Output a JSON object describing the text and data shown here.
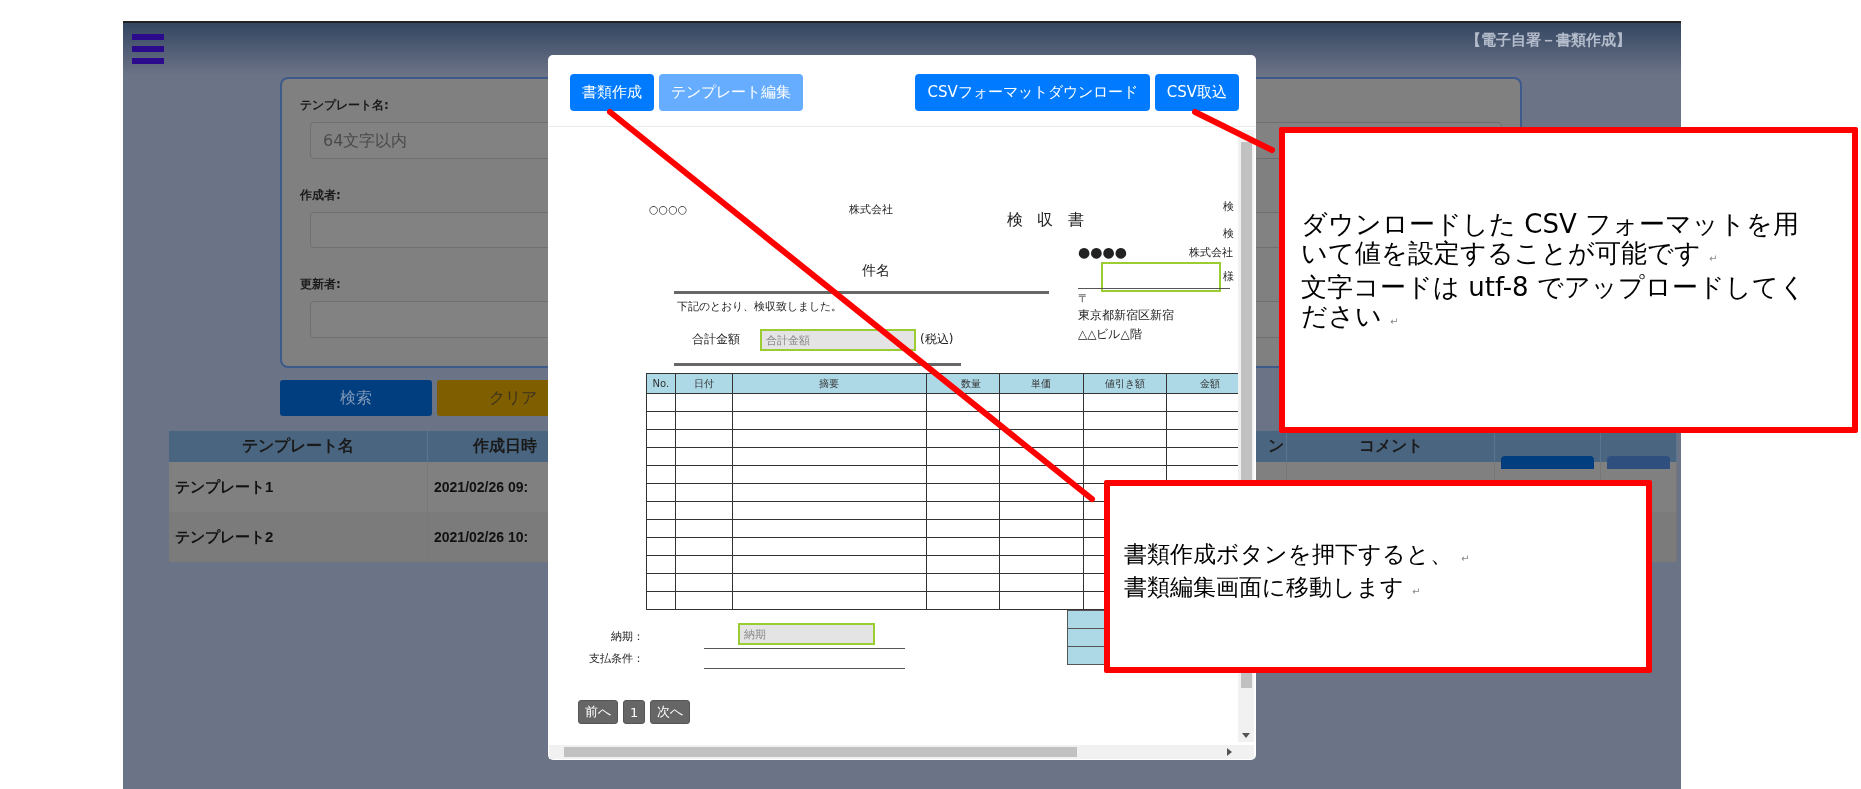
{
  "app_header": {
    "title": "【電子自署－書類作成】"
  },
  "search_form": {
    "fields": [
      {
        "label": "テンプレート名:",
        "placeholder": "64文字以内"
      },
      {
        "label": "作成者:"
      },
      {
        "label": "更新者:"
      }
    ],
    "buttons": [
      {
        "label": "検索",
        "kind": "primary"
      },
      {
        "label": "クリア",
        "kind": "warning"
      }
    ]
  },
  "template_table": {
    "columns": [
      "テンプレート名",
      "作成日時",
      "ン",
      "コメント"
    ],
    "rows": [
      {
        "cells": [
          "テンプレート1",
          "2021/02/26 09:"
        ]
      },
      {
        "cells": [
          "テンプレート2",
          "2021/02/26 10:"
        ]
      }
    ]
  },
  "modal": {
    "buttons": [
      {
        "label": "書類作成",
        "disabled": false
      },
      {
        "label": "テンプレート編集",
        "disabled": true
      },
      {
        "label": "CSVフォーマットダウンロード",
        "disabled": false
      },
      {
        "label": "CSV取込",
        "disabled": false
      }
    ],
    "document": {
      "sender": "○○○○",
      "sender_suffix": "株式会社",
      "title": "検収書",
      "right_labels": [
        "検",
        "検"
      ],
      "subject": "件名",
      "statement": "下記のとおり、検収致しました。",
      "total_label": "合計金額",
      "total_field": {
        "placeholder": "合計金額"
      },
      "tax_note": "(税込)",
      "recipient": {
        "name": "●●●●",
        "suffix": "株式会社",
        "honorific": "様",
        "postal_mark": "〒",
        "address_lines": [
          "東京都新宿区新宿",
          "△△ビル△階"
        ]
      },
      "items_table": {
        "columns": [
          "No.",
          "日付",
          "摘要",
          "数量",
          "単価",
          "値引き額",
          "金額"
        ]
      },
      "delivery": {
        "label": "納期：",
        "placeholder": "納期"
      },
      "payment_label": "支払条件："
    },
    "pagination": [
      "前へ",
      "1",
      "次へ"
    ]
  },
  "callouts": [
    {
      "lines": [
        {
          "text": "ダウンロードした CSV フォーマットを用"
        },
        {
          "text": "いて値を設定することが可能です",
          "end_mark": "↵"
        },
        {
          "text": "文字コードは utf-8 でアップロードしてく"
        },
        {
          "text": "ださい",
          "end_mark": "↵"
        }
      ]
    },
    {
      "lines": [
        {
          "text": "書類作成ボタンを押下すると、",
          "end_mark": "↵"
        },
        {
          "text": "書類編集画面に移動します",
          "end_mark": "↵"
        }
      ]
    }
  ]
}
